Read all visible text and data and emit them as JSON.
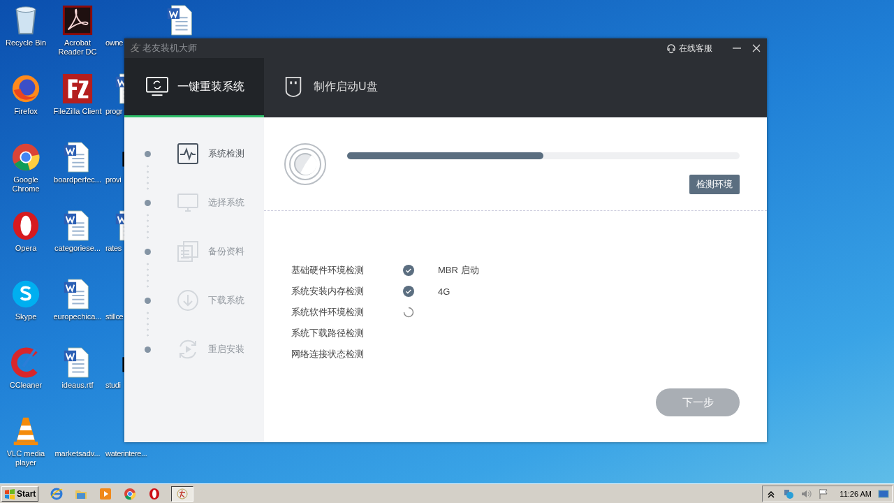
{
  "desktop": {
    "columns": [
      [
        {
          "label": "Recycle Bin",
          "kind": "recycle"
        },
        {
          "label": "Firefox",
          "kind": "firefox"
        },
        {
          "label": "Google Chrome",
          "kind": "chrome"
        },
        {
          "label": "Opera",
          "kind": "opera"
        },
        {
          "label": "Skype",
          "kind": "skype"
        },
        {
          "label": "CCleaner",
          "kind": "ccleaner"
        },
        {
          "label": "VLC media player",
          "kind": "vlc"
        }
      ],
      [
        {
          "label": "Acrobat Reader DC",
          "kind": "acrobat"
        },
        {
          "label": "FileZilla Client",
          "kind": "filezilla"
        },
        {
          "label": "boardperfec...",
          "kind": "word"
        },
        {
          "label": "categoriese...",
          "kind": "word"
        },
        {
          "label": "europechica...",
          "kind": "word"
        },
        {
          "label": "ideaus.rtf",
          "kind": "word"
        },
        {
          "label": "marketsadv..."
        }
      ],
      [
        {
          "label": "owne"
        },
        {
          "label": "progr",
          "kind": "word"
        },
        {
          "label": "provi",
          "kind": "black"
        },
        {
          "label": "rates",
          "kind": "word"
        },
        {
          "label": "stillce"
        },
        {
          "label": "studi",
          "kind": "black"
        },
        {
          "label": "waterintere..."
        }
      ],
      [
        {
          "kind": "word"
        }
      ]
    ]
  },
  "window": {
    "logo": "友",
    "title": "老友装机大师",
    "support": "在线客服",
    "tabs": [
      {
        "label": "一键重装系统",
        "kind": "reinstall",
        "selected": true
      },
      {
        "label": "制作启动U盘",
        "kind": "usb",
        "selected": false
      }
    ],
    "steps": [
      {
        "label": "系统检测",
        "kind": "pulse",
        "active": true
      },
      {
        "label": "选择系统",
        "kind": "monitor",
        "active": false
      },
      {
        "label": "备份资料",
        "kind": "docs",
        "active": false
      },
      {
        "label": "下载系统",
        "kind": "download",
        "active": false
      },
      {
        "label": "重启安装",
        "kind": "restart",
        "active": false
      }
    ],
    "progress": {
      "level": 0.5
    },
    "stage_button": "检测环境",
    "checks": [
      {
        "label": "基础硬件环境检测",
        "done": true,
        "loading": false,
        "value": "MBR 启动"
      },
      {
        "label": "系统安装内存检测",
        "done": true,
        "loading": false,
        "value": "4G"
      },
      {
        "label": "系统软件环境检测",
        "done": false,
        "loading": true
      },
      {
        "label": "系统下载路径检测",
        "done": false,
        "loading": false
      },
      {
        "label": "网络连接状态检测",
        "done": false,
        "loading": false
      }
    ],
    "next_button": {
      "label": "下一步",
      "disabled": true
    }
  },
  "taskbar": {
    "start": "Start",
    "quick_launch": [
      {
        "kind": "ie"
      },
      {
        "kind": "folder"
      },
      {
        "kind": "media"
      },
      {
        "kind": "chrome"
      },
      {
        "kind": "opera"
      }
    ],
    "tasks": [
      {
        "kind": "app",
        "selected": true
      }
    ],
    "clock": "11:26 AM"
  }
}
